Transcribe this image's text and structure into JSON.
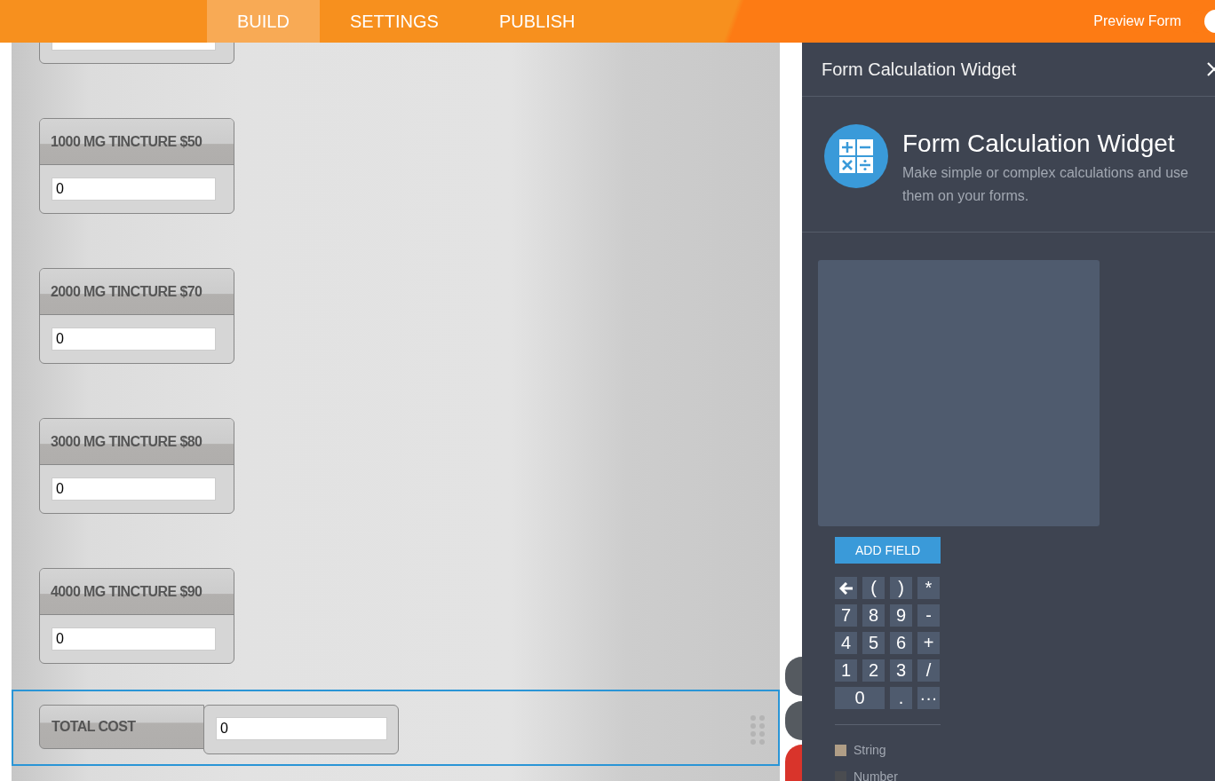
{
  "top_bar": {
    "tabs": [
      {
        "label": "BUILD",
        "selected": true
      },
      {
        "label": "SETTINGS",
        "selected": false
      },
      {
        "label": "PUBLISH",
        "selected": false
      }
    ],
    "preview": {
      "label": "Preview Form",
      "on": true
    }
  },
  "form": {
    "fields": [
      {
        "kind": "partial"
      },
      {
        "kind": "field",
        "label": "1000 MG TINCTURE $50",
        "value": "0"
      },
      {
        "kind": "field",
        "label": "2000 MG TINCTURE $70",
        "value": "0"
      },
      {
        "kind": "field",
        "label": "3000 MG TINCTURE $80",
        "value": "0"
      },
      {
        "kind": "field",
        "label": "4000 MG TINCTURE $90",
        "value": "0"
      }
    ],
    "total": {
      "label": "TOTAL COST",
      "value": "0",
      "selected": true
    }
  },
  "panel": {
    "header": "Form Calculation Widget",
    "title": "Form Calculation Widget",
    "description": "Make simple or complex calculations and use them on your forms.",
    "add_button": "ADD FIELD",
    "keys": [
      {
        "kind": "back"
      },
      {
        "kind": "key",
        "label": "("
      },
      {
        "kind": "key",
        "label": ")"
      },
      {
        "kind": "key",
        "label": "*"
      },
      {
        "kind": "key",
        "label": "7"
      },
      {
        "kind": "key",
        "label": "8"
      },
      {
        "kind": "key",
        "label": "9"
      },
      {
        "kind": "key",
        "label": "-"
      },
      {
        "kind": "key",
        "label": "4"
      },
      {
        "kind": "key",
        "label": "5"
      },
      {
        "kind": "key",
        "label": "6"
      },
      {
        "kind": "key",
        "label": "+"
      },
      {
        "kind": "key",
        "label": "1"
      },
      {
        "kind": "key",
        "label": "2"
      },
      {
        "kind": "key",
        "label": "3"
      },
      {
        "kind": "key",
        "label": "/"
      },
      {
        "kind": "wide",
        "label": "0"
      },
      {
        "kind": "key",
        "label": "."
      },
      {
        "kind": "key",
        "label": "···"
      }
    ],
    "legend": [
      {
        "label": "String",
        "color": "#b09e86"
      },
      {
        "label": "Number",
        "color": "#4a4c50"
      }
    ]
  }
}
